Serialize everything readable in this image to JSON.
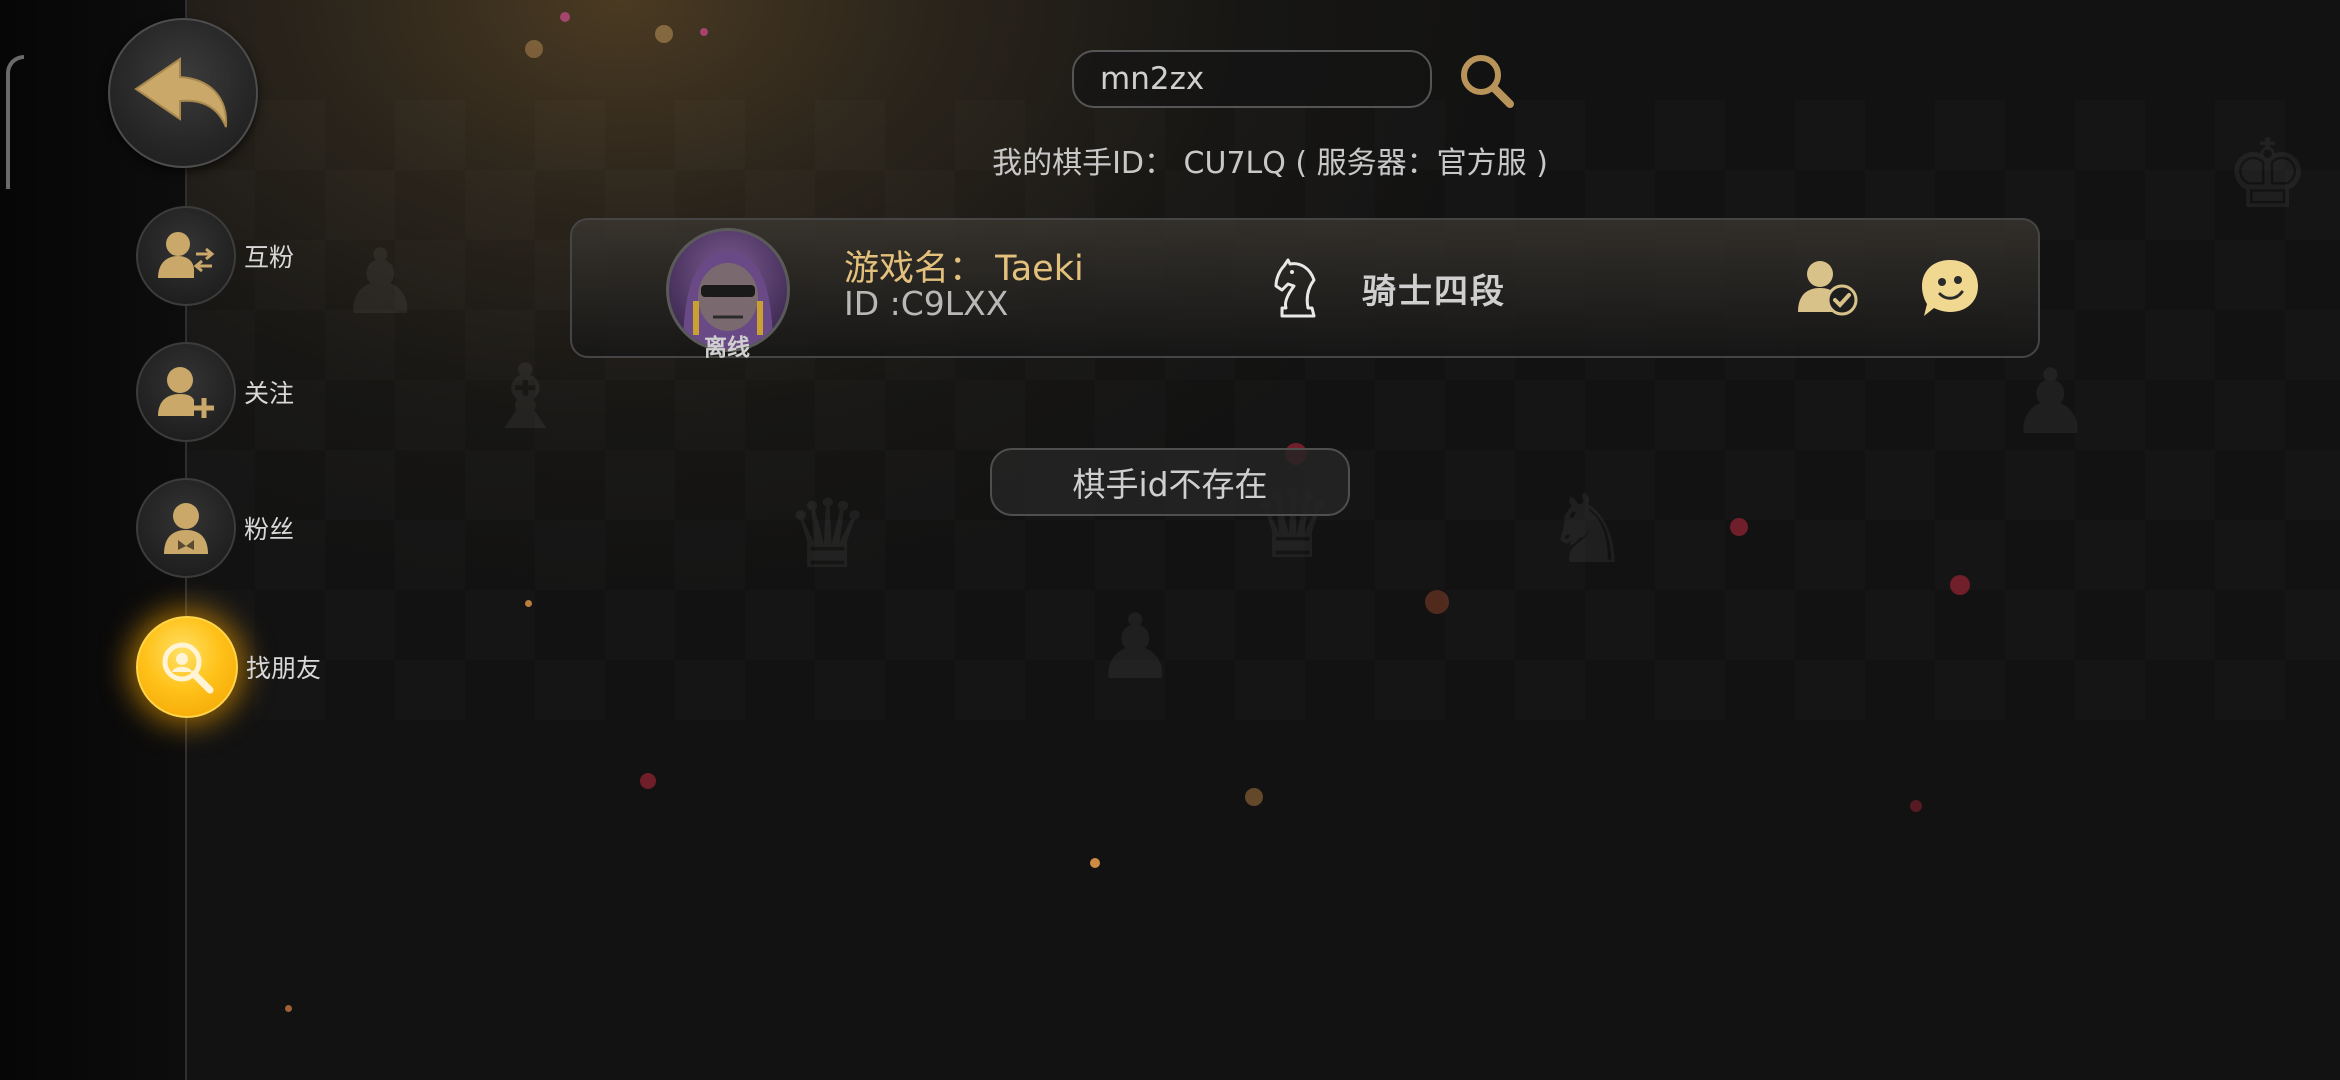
{
  "search": {
    "value": "mn2zx",
    "placeholder": ""
  },
  "my_id_line": "我的棋手ID： CU7LQ ( 服务器：官方服 )",
  "sidebar": {
    "items": [
      {
        "label": "互粉",
        "icon": "mutual-follow-icon"
      },
      {
        "label": "关注",
        "icon": "add-follow-icon"
      },
      {
        "label": "粉丝",
        "icon": "fans-icon"
      },
      {
        "label": "找朋友",
        "icon": "find-friend-icon",
        "active": true
      }
    ]
  },
  "result": {
    "status": "离线",
    "game_name": "游戏名： Taeki",
    "id": "ID :C9LXX",
    "rank": "骑士四段"
  },
  "toast": "棋手id不存在",
  "colors": {
    "accent": "#ffc21a",
    "gold_text": "#e3c17c",
    "icon_gold": "#c9a86a"
  }
}
